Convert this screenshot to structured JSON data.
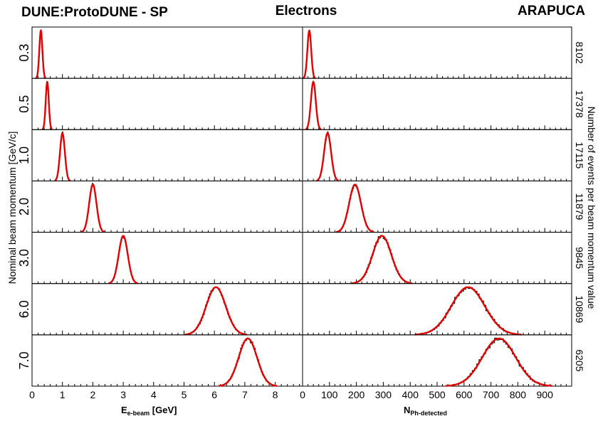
{
  "header": {
    "left": "DUNE:ProtoDUNE - SP",
    "center": "Electrons",
    "right": "ARAPUCA"
  },
  "axes": {
    "left_y_title": "Nominal beam momentum [GeV/c]",
    "right_y_title": "Number of events per beam momentum value",
    "x_left_main": "E",
    "x_left_sub": "e-beam",
    "x_left_unit": " [GeV]",
    "x_right_main": "N",
    "x_right_sub": "Ph-detected"
  },
  "chart_data": {
    "type": "histogram-grid",
    "panels": {
      "left": {
        "xlim": [
          0,
          8.9
        ],
        "ticks": [
          0,
          1,
          2,
          3,
          4,
          5,
          6,
          7,
          8
        ]
      },
      "right": {
        "xlim": [
          0,
          1000
        ],
        "ticks": [
          0,
          100,
          200,
          300,
          400,
          500,
          600,
          700,
          800,
          900
        ]
      }
    },
    "rows": [
      {
        "momentum": "0.3",
        "events": "8102",
        "energy_mean": 0.29,
        "energy_sigma": 0.05,
        "photons_mean": 25,
        "photons_sigma": 7
      },
      {
        "momentum": "0.5",
        "events": "17378",
        "energy_mean": 0.5,
        "energy_sigma": 0.05,
        "photons_mean": 40,
        "photons_sigma": 9
      },
      {
        "momentum": "1.0",
        "events": "17115",
        "energy_mean": 1.0,
        "energy_sigma": 0.08,
        "photons_mean": 93,
        "photons_sigma": 13
      },
      {
        "momentum": "2.0",
        "events": "11879",
        "energy_mean": 2.0,
        "energy_sigma": 0.12,
        "photons_mean": 195,
        "photons_sigma": 22
      },
      {
        "momentum": "3.0",
        "events": "9845",
        "energy_mean": 3.0,
        "energy_sigma": 0.15,
        "photons_mean": 295,
        "photons_sigma": 35
      },
      {
        "momentum": "6.0",
        "events": "10869",
        "energy_mean": 6.05,
        "energy_sigma": 0.32,
        "photons_mean": 615,
        "photons_sigma": 62
      },
      {
        "momentum": "7.0",
        "events": "6205",
        "energy_mean": 7.1,
        "energy_sigma": 0.3,
        "photons_mean": 730,
        "photons_sigma": 62
      }
    ],
    "fit_color": "#e00000",
    "histogram_color": "#000000",
    "grid": false
  }
}
